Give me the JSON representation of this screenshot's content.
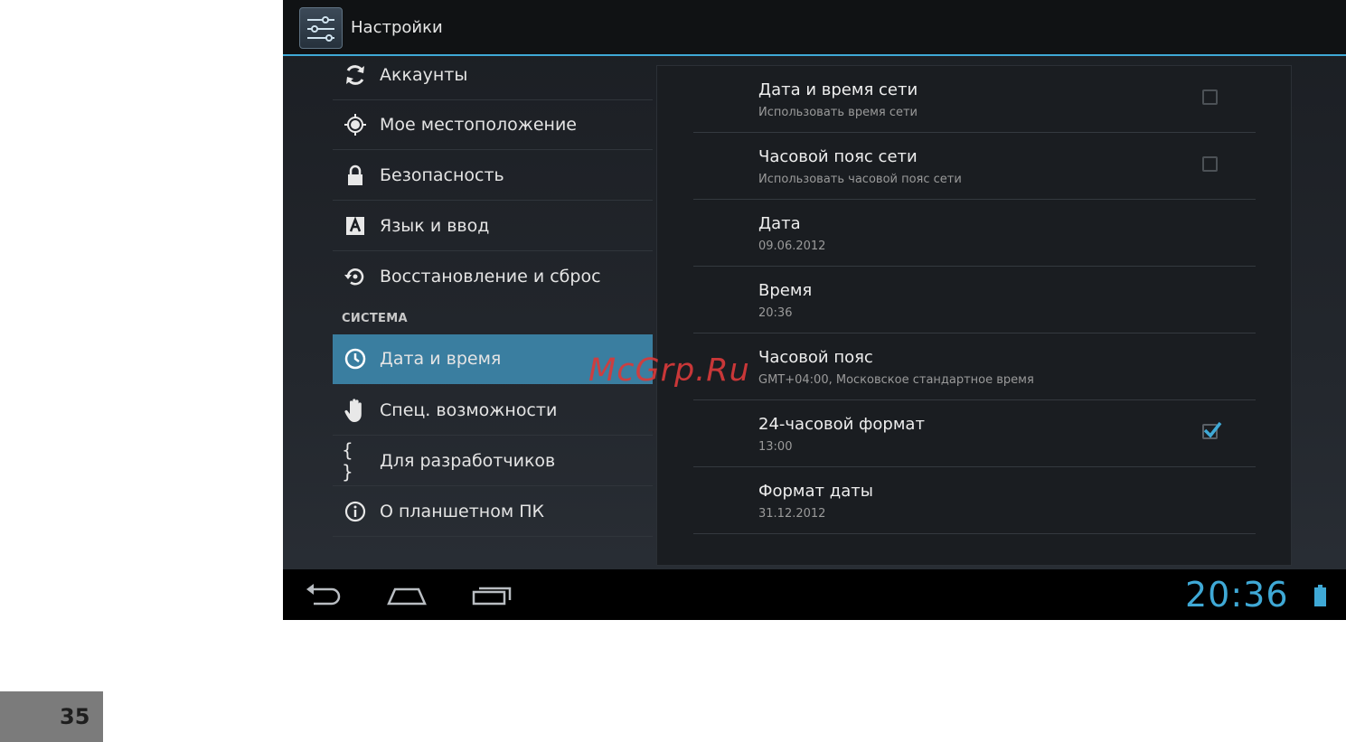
{
  "app": {
    "title": "Настройки"
  },
  "sidebar": {
    "items": [
      {
        "label": "Аккаунты",
        "icon": "sync-icon"
      },
      {
        "label": "Мое местоположение",
        "icon": "location-icon"
      },
      {
        "label": "Безопасность",
        "icon": "lock-icon"
      },
      {
        "label": "Язык и ввод",
        "icon": "keyboard-letter-icon"
      },
      {
        "label": "Восстановление и сброс",
        "icon": "restore-icon"
      }
    ],
    "section_header": "СИСТЕМА",
    "system_items": [
      {
        "label": "Дата и время",
        "icon": "clock-icon",
        "selected": true
      },
      {
        "label": "Спец. возможности",
        "icon": "hand-icon"
      },
      {
        "label": "Для разработчиков",
        "icon": "braces-icon"
      },
      {
        "label": "О планшетном ПК",
        "icon": "info-icon"
      }
    ]
  },
  "settings": {
    "rows": [
      {
        "title": "Дата и время сети",
        "subtitle": "Использовать время сети",
        "checkbox": false
      },
      {
        "title": "Часовой пояс сети",
        "subtitle": "Использовать часовой пояс сети",
        "checkbox": false
      },
      {
        "title": "Дата",
        "subtitle": "09.06.2012"
      },
      {
        "title": "Время",
        "subtitle": "20:36"
      },
      {
        "title": "Часовой пояс",
        "subtitle": "GMT+04:00, Московское стандартное время"
      },
      {
        "title": "24-часовой формат",
        "subtitle": "13:00",
        "checkbox": true
      },
      {
        "title": "Формат даты",
        "subtitle": "31.12.2012"
      }
    ]
  },
  "navbar": {
    "clock": "20:36",
    "buttons": [
      "back-icon",
      "home-icon",
      "recent-apps-icon"
    ],
    "battery_icon": "battery-icon"
  },
  "colors": {
    "accent": "#3fa9d6",
    "selected": "#3a7ea0",
    "watermark": "#d83a3a"
  },
  "watermark": "McGrp.Ru",
  "page_number": "35"
}
